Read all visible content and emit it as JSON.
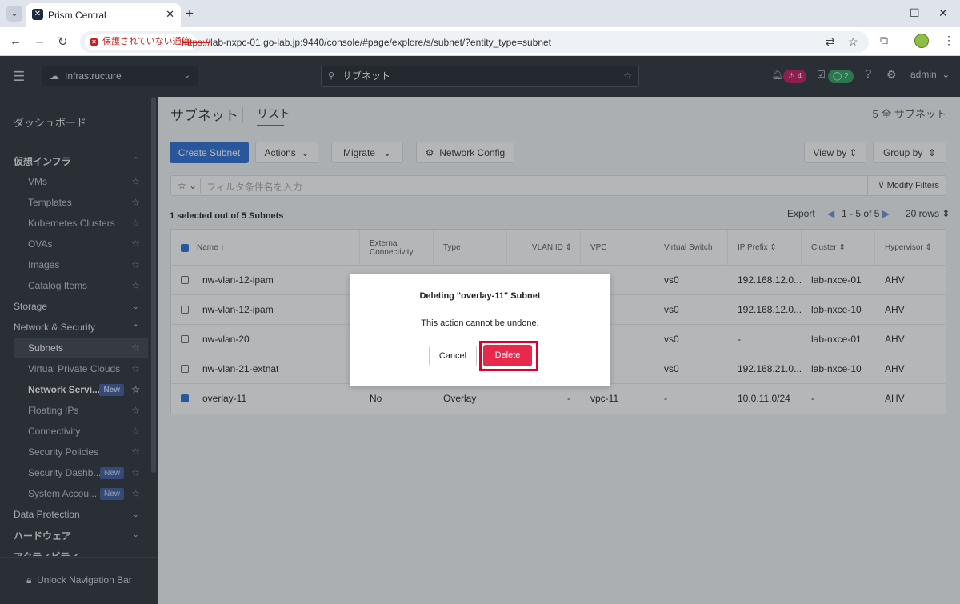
{
  "browser": {
    "tab_title": "Prism Central",
    "insecure_label": "保護されていない通信",
    "url_scheme": "https://",
    "url_rest": "lab-nxpc-01.go-lab.jp:9440/console/#page/explore/s/subnet/?entity_type=subnet"
  },
  "topbar": {
    "context": "Infrastructure",
    "search_value": "サブネット",
    "alerts_count": "4",
    "tasks_count": "2",
    "user": "admin"
  },
  "sidebar": {
    "dashboard": "ダッシュボード",
    "virtual_infra": "仮想インフラ",
    "vi_items": [
      "VMs",
      "Templates",
      "Kubernetes Clusters",
      "OVAs",
      "Images",
      "Catalog Items"
    ],
    "storage": "Storage",
    "network_security": "Network & Security",
    "ns_items": [
      "Subnets",
      "Virtual Private Clouds",
      "Network Servi...",
      "Floating IPs",
      "Connectivity",
      "Security Policies",
      "Security Dashb...",
      "System Accou..."
    ],
    "new_badge": "New",
    "data_protection": "Data Protection",
    "hardware": "ハードウェア",
    "activity": "アクティビティ",
    "unlock": "Unlock Navigation Bar"
  },
  "page": {
    "title": "サブネット",
    "list_tab": "リスト",
    "total": "5 全 サブネット",
    "create": "Create Subnet",
    "actions": "Actions",
    "migrate": "Migrate",
    "network_config": "Network Config",
    "view_by": "View by",
    "group_by": "Group by",
    "filter_placeholder": "フィルタ条件名を入力",
    "modify_filters": "Modify Filters",
    "selection_info": "1 selected out of 5 Subnets",
    "export": "Export",
    "range": "1 - 5 of 5",
    "rows": "20 rows"
  },
  "table": {
    "headers": [
      "Name",
      "External Connectivity",
      "Type",
      "VLAN ID",
      "VPC",
      "Virtual Switch",
      "IP Prefix",
      "Cluster",
      "Hypervisor"
    ],
    "rows": [
      {
        "name": "nw-vlan-12-ipam",
        "ext": "",
        "type": "",
        "vlan": "",
        "vpc": "",
        "vs": "vs0",
        "prefix": "192.168.12.0...",
        "cluster": "lab-nxce-01",
        "hv": "AHV"
      },
      {
        "name": "nw-vlan-12-ipam",
        "ext": "",
        "type": "",
        "vlan": "",
        "vpc": "",
        "vs": "vs0",
        "prefix": "192.168.12.0...",
        "cluster": "lab-nxce-10",
        "hv": "AHV"
      },
      {
        "name": "nw-vlan-20",
        "ext": "",
        "type": "",
        "vlan": "",
        "vpc": "",
        "vs": "vs0",
        "prefix": "-",
        "cluster": "lab-nxce-01",
        "hv": "AHV"
      },
      {
        "name": "nw-vlan-21-extnat",
        "ext": "",
        "type": "",
        "vlan": "",
        "vpc": "",
        "vs": "vs0",
        "prefix": "192.168.21.0...",
        "cluster": "lab-nxce-10",
        "hv": "AHV"
      },
      {
        "name": "overlay-11",
        "ext": "No",
        "type": "Overlay",
        "vlan": "-",
        "vpc": "vpc-11",
        "vs": "-",
        "prefix": "10.0.11.0/24",
        "cluster": "-",
        "hv": "AHV"
      }
    ]
  },
  "modal": {
    "title": "Deleting \"overlay-11\" Subnet",
    "message": "This action cannot be undone.",
    "cancel": "Cancel",
    "delete": "Delete"
  }
}
